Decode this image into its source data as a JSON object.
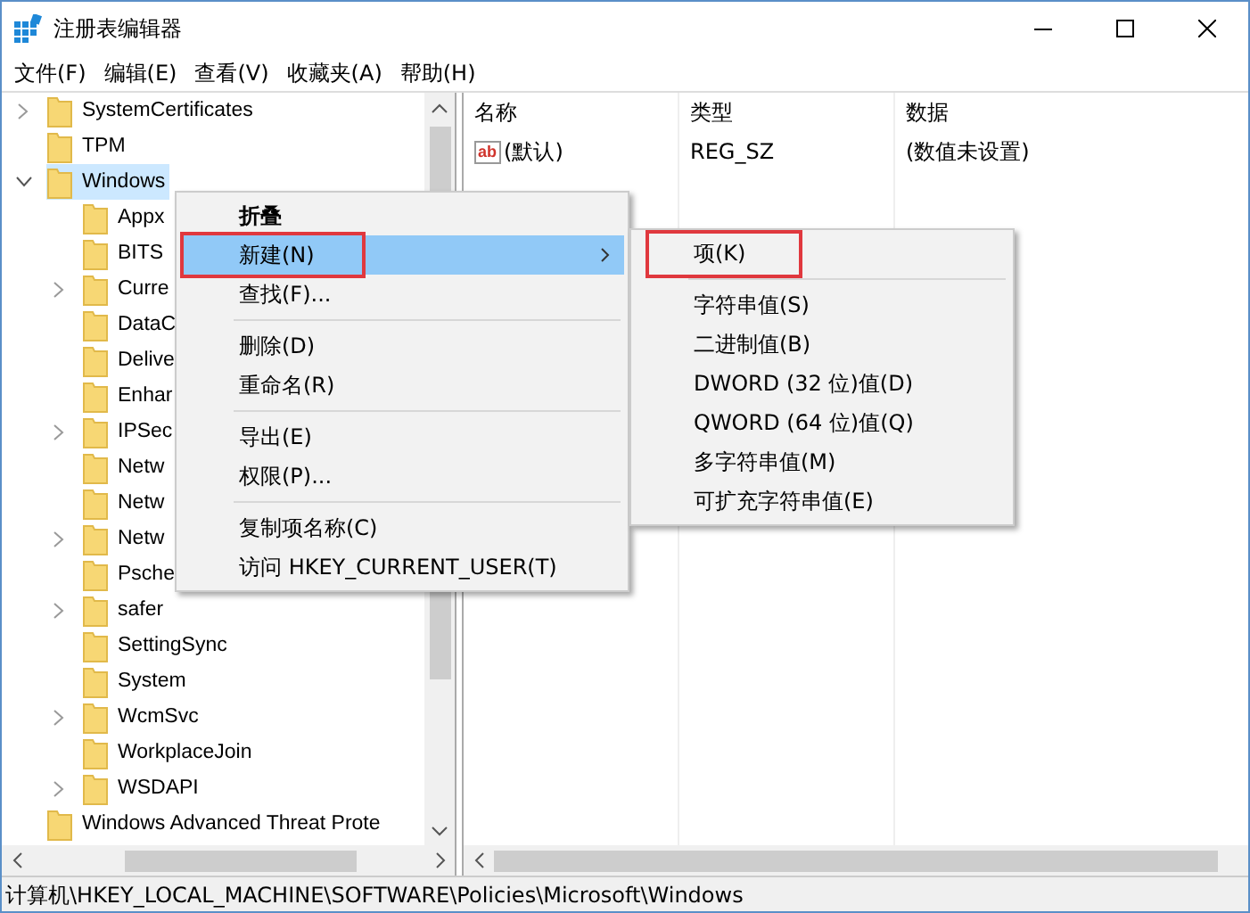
{
  "window": {
    "title": "注册表编辑器"
  },
  "menu_bar": [
    "文件(F)",
    "编辑(E)",
    "查看(V)",
    "收藏夹(A)",
    "帮助(H)"
  ],
  "tree": [
    {
      "label": "SystemCertificates",
      "expanded": false,
      "selected": false
    },
    {
      "label": "TPM",
      "selected": false
    },
    {
      "label": "Windows",
      "expanded": true,
      "selected": true,
      "children": [
        {
          "label": "Appx",
          "selected": false
        },
        {
          "label": "BITS",
          "selected": false
        },
        {
          "label": "Curre",
          "expanded": false,
          "selected": false
        },
        {
          "label": "DataC",
          "selected": false
        },
        {
          "label": "Delive",
          "selected": false
        },
        {
          "label": "Enhar",
          "selected": false
        },
        {
          "label": "IPSec",
          "expanded": false,
          "selected": false
        },
        {
          "label": "Netw",
          "selected": false
        },
        {
          "label": "Netw",
          "selected": false
        },
        {
          "label": "Netw",
          "expanded": false,
          "selected": false
        },
        {
          "label": "Psche",
          "selected": false
        },
        {
          "label": "safer",
          "expanded": false,
          "selected": false
        },
        {
          "label": "SettingSync",
          "selected": false
        },
        {
          "label": "System",
          "selected": false
        },
        {
          "label": "WcmSvc",
          "expanded": false,
          "selected": false
        },
        {
          "label": "WorkplaceJoin",
          "selected": false
        },
        {
          "label": "WSDAPI",
          "expanded": false,
          "selected": false
        }
      ]
    },
    {
      "label": "Windows Advanced Threat Prote",
      "selected": false
    }
  ],
  "values_table": {
    "columns": [
      "名称",
      "类型",
      "数据"
    ],
    "rows": [
      {
        "icon_text": "ab",
        "name": "(默认)",
        "type": "REG_SZ",
        "data": "(数值未设置)"
      }
    ]
  },
  "context_menu": [
    {
      "kind": "default",
      "label": "折叠",
      "selected": false,
      "highlighted": false
    },
    {
      "kind": "submenu",
      "label": "新建(N)",
      "selected": true,
      "highlighted": true
    },
    {
      "kind": "item",
      "label": "查找(F)...",
      "selected": false,
      "highlighted": false
    },
    {
      "kind": "separator"
    },
    {
      "kind": "item",
      "label": "删除(D)",
      "selected": false,
      "highlighted": false
    },
    {
      "kind": "item",
      "label": "重命名(R)",
      "selected": false,
      "highlighted": false
    },
    {
      "kind": "separator"
    },
    {
      "kind": "item",
      "label": "导出(E)",
      "selected": false,
      "highlighted": false
    },
    {
      "kind": "item",
      "label": "权限(P)...",
      "selected": false,
      "highlighted": false
    },
    {
      "kind": "separator"
    },
    {
      "kind": "item",
      "label": "复制项名称(C)",
      "selected": false,
      "highlighted": false
    },
    {
      "kind": "item",
      "label": "访问 HKEY_CURRENT_USER(T)",
      "selected": false,
      "highlighted": false
    }
  ],
  "submenu": [
    {
      "kind": "item",
      "label": "项(K)",
      "selected": false,
      "highlighted": true
    },
    {
      "kind": "separator"
    },
    {
      "kind": "item",
      "label": "字符串值(S)",
      "selected": false,
      "highlighted": false
    },
    {
      "kind": "item",
      "label": "二进制值(B)",
      "selected": false,
      "highlighted": false
    },
    {
      "kind": "item",
      "label": "DWORD (32 位)值(D)",
      "selected": false,
      "highlighted": false
    },
    {
      "kind": "item",
      "label": "QWORD (64 位)值(Q)",
      "selected": false,
      "highlighted": false
    },
    {
      "kind": "item",
      "label": "多字符串值(M)",
      "selected": false,
      "highlighted": false
    },
    {
      "kind": "item",
      "label": "可扩充字符串值(E)",
      "selected": false,
      "highlighted": false
    }
  ],
  "status_bar": "计算机\\HKEY_LOCAL_MACHINE\\SOFTWARE\\Policies\\Microsoft\\Windows"
}
